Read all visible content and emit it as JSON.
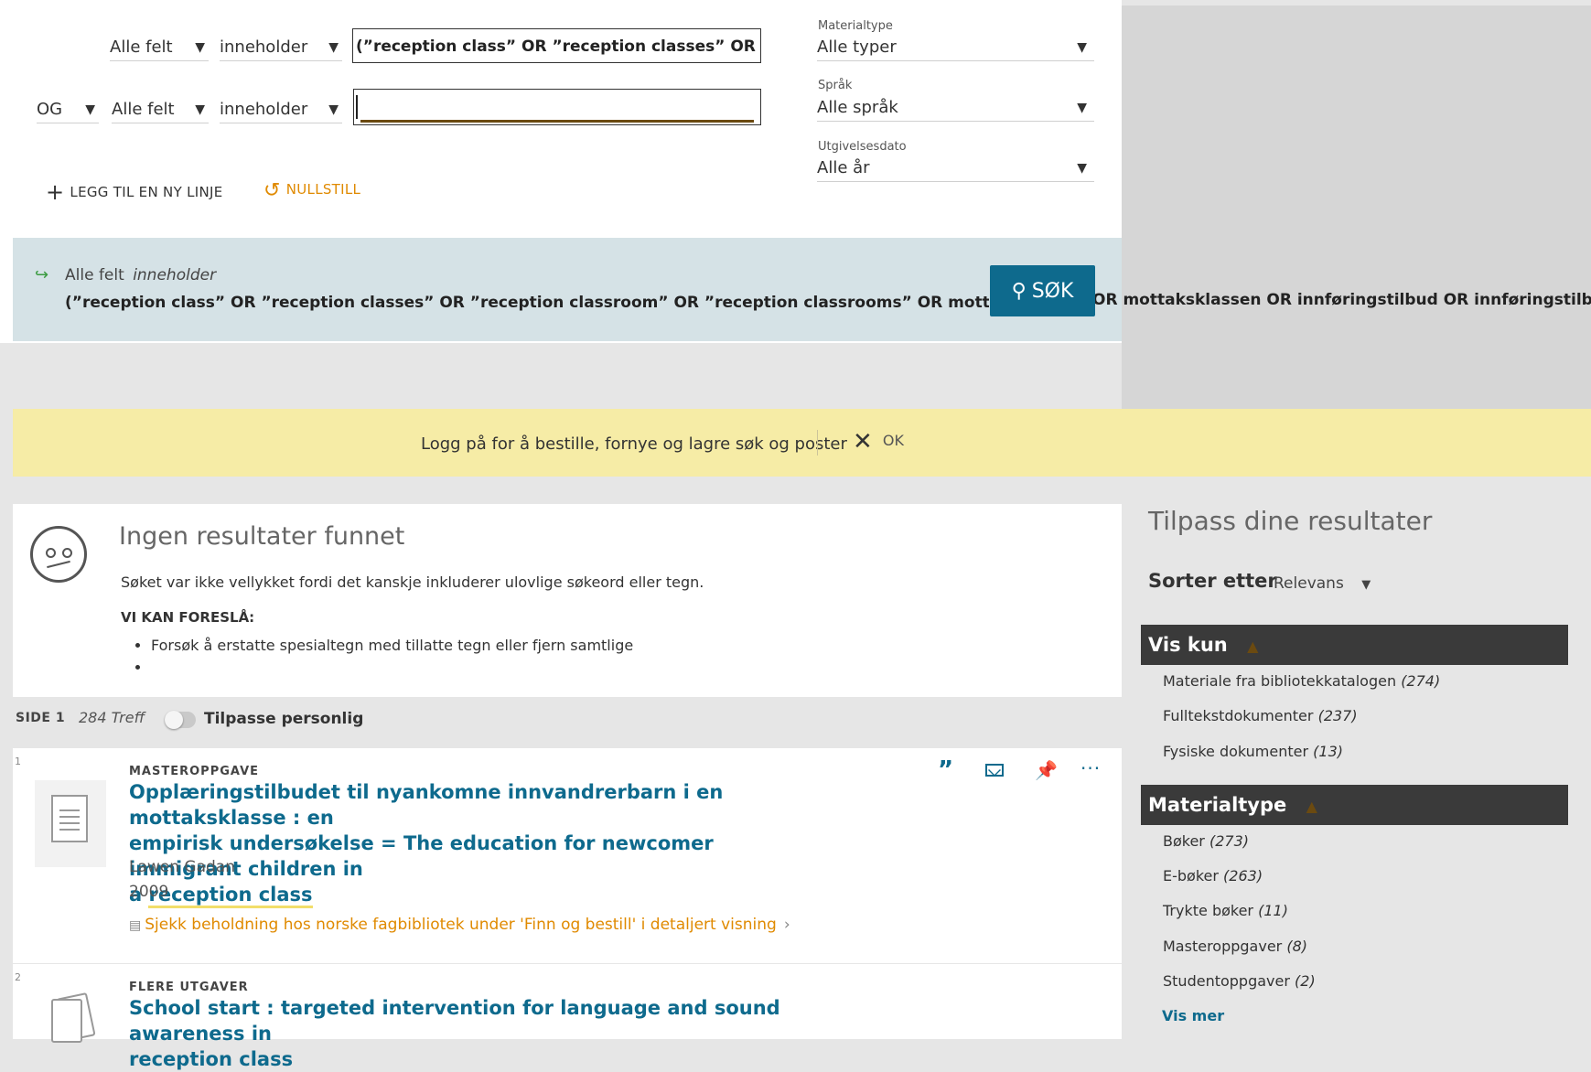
{
  "search": {
    "rows": [
      {
        "operator": "",
        "field": "Alle felt",
        "condition": "inneholder",
        "value": "(”reception class” OR ”reception classes” OR ”recept"
      },
      {
        "operator": "OG",
        "field": "Alle felt",
        "condition": "inneholder",
        "value": ""
      }
    ],
    "add_line_label": "LEGG TIL EN NY LINJE",
    "reset_label": "NULLSTILL",
    "search_button_label": "SØK"
  },
  "facets_top": {
    "material_label": "Materialtype",
    "material_value": "Alle typer",
    "language_label": "Språk",
    "language_value": "Alle språk",
    "date_label": "Utgivelsesdato",
    "date_value": "Alle år"
  },
  "summary": {
    "field": "Alle felt",
    "condition": "inneholder",
    "query_text": "(”reception class” OR ”reception classes” OR ”reception classroom” OR ”reception classrooms” OR mottaksklasse OR mo",
    "query_overflow": "OR mottaksklassen OR innføringstilbud OR innføringstilbudet OR"
  },
  "login_banner": {
    "text": "Logg på for å bestille, fornye og lagre søk og poster",
    "ok_label": "OK"
  },
  "no_results": {
    "title": "Ingen resultater funnet",
    "message": "Søket var ikke vellykket fordi det kanskje inkluderer ulovlige søkeord eller tegn.",
    "suggest_heading": "VI KAN FORESLÅ:",
    "suggestions": [
      "Forsøk å erstatte spesialtegn med tillatte tegn eller fjern samtlige",
      ""
    ]
  },
  "result_bar": {
    "page": "SIDE 1",
    "hits": "284 Treff",
    "personalize_label": "Tilpasse personlig"
  },
  "results": [
    {
      "number": "1",
      "type": "MASTEROPPGAVE",
      "title_line1": "Opplæringstilbudet til nyankomne innvandrerbarn i en mottaksklasse : en",
      "title_line2": "empirisk undersøkelse = The education for newcomer immigrant children in",
      "title_line3_prefix": "a ",
      "title_line3_highlight": "reception class",
      "author": "Lawen Gadan",
      "year": "2009",
      "availability": "Sjekk beholdning hos norske fagbibliotek under 'Finn og bestill' i detaljert visning"
    },
    {
      "number": "2",
      "type": "FLERE UTGAVER",
      "title_line1": "School start : targeted intervention for language and sound awareness in",
      "title_line2": "reception class"
    }
  ],
  "sidebar": {
    "title": "Tilpass dine resultater",
    "sort_label": "Sorter etter",
    "sort_value": "Relevans",
    "groups": [
      {
        "heading": "Vis kun",
        "items": [
          {
            "label": "Materiale fra bibliotekkatalogen",
            "count": "(274)"
          },
          {
            "label": "Fulltekstdokumenter",
            "count": "(237)"
          },
          {
            "label": "Fysiske dokumenter",
            "count": "(13)"
          }
        ]
      },
      {
        "heading": "Materialtype",
        "items": [
          {
            "label": "Bøker",
            "count": "(273)"
          },
          {
            "label": "E-bøker",
            "count": "(263)"
          },
          {
            "label": "Trykte bøker",
            "count": "(11)"
          },
          {
            "label": "Masteroppgaver",
            "count": "(8)"
          },
          {
            "label": "Studentoppgaver",
            "count": "(2)"
          }
        ],
        "more_label": "Vis mer"
      }
    ]
  },
  "colors": {
    "link": "#0e6a8d",
    "accent_orange": "#e08a00",
    "banner": "#f6eca6",
    "summary_bg": "#d5e2e6"
  }
}
